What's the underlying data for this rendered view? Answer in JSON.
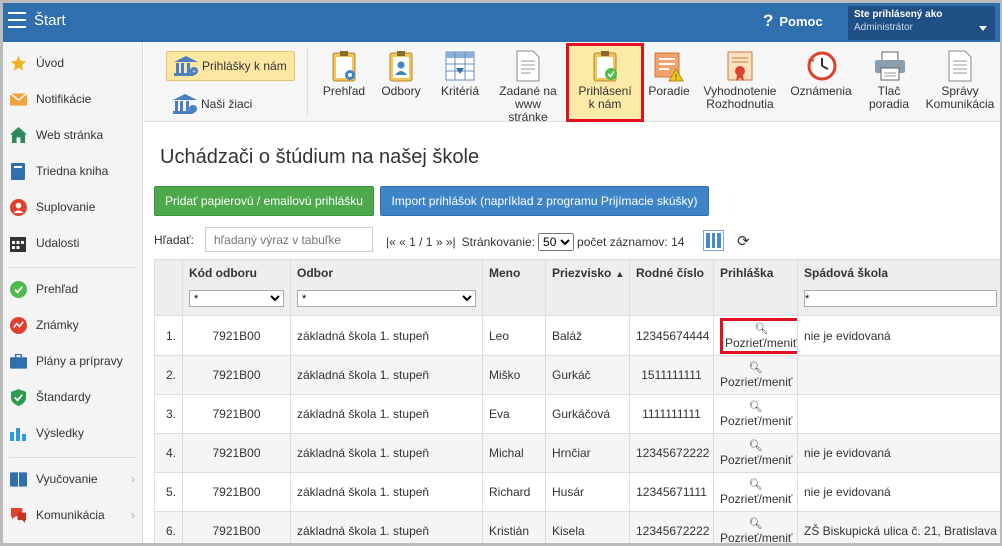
{
  "topbar": {
    "title": "Štart",
    "help_label": "Pomoc",
    "user_line1": "Ste prihlásený ako",
    "user_line2": "Administrátor"
  },
  "sidebar": {
    "items": [
      {
        "label": "Úvod",
        "icon": "star-icon"
      },
      {
        "label": "Notifikácie",
        "icon": "envelope-icon"
      },
      {
        "label": "Web stránka",
        "icon": "house-icon"
      },
      {
        "label": "Triedna kniha",
        "icon": "book-icon"
      },
      {
        "label": "Suplovanie",
        "icon": "person-icon"
      },
      {
        "label": "Udalosti",
        "icon": "calendar-icon"
      },
      {
        "label": "Prehľad",
        "icon": "check-circle-icon"
      },
      {
        "label": "Známky",
        "icon": "chart-circle-icon"
      },
      {
        "label": "Plány a prípravy",
        "icon": "briefcase-icon"
      },
      {
        "label": "Štandardy",
        "icon": "shield-icon"
      },
      {
        "label": "Výsledky",
        "icon": "bar-chart-icon"
      },
      {
        "label": "Vyučovanie",
        "icon": "books-icon"
      },
      {
        "label": "Komunikácia",
        "icon": "chat-icon"
      }
    ]
  },
  "toolbar": {
    "left": [
      {
        "label": "Prihlášky k nám",
        "icon": "school-icon"
      },
      {
        "label": "Naši žiaci",
        "icon": "school-icon"
      }
    ],
    "items": [
      {
        "line1": "Prehľad",
        "line2": "",
        "icon": "clipboard-eye-icon"
      },
      {
        "line1": "Odbory",
        "line2": "",
        "icon": "clipboard-person-icon"
      },
      {
        "line1": "Kritériá",
        "line2": "",
        "icon": "table-icon"
      },
      {
        "line1": "Zadané na",
        "line2": "www stránke",
        "icon": "document-icon"
      },
      {
        "line1": "Prihlásení",
        "line2": "k nám",
        "icon": "clipboard-check-icon"
      },
      {
        "line1": "Poradie",
        "line2": "",
        "icon": "warning-list-icon"
      },
      {
        "line1": "Vyhodnotenie",
        "line2": "Rozhodnutia",
        "icon": "certificate-icon"
      },
      {
        "line1": "Oznámenia",
        "line2": "",
        "icon": "clock-icon"
      },
      {
        "line1": "Tlač",
        "line2": "poradia",
        "icon": "printer-icon"
      },
      {
        "line1": "Správy",
        "line2": "Komunikácia",
        "icon": "message-icon"
      }
    ]
  },
  "main": {
    "title": "Uchádzači o štúdium na našej škole",
    "btn_add": "Pridať papierovú / emailovú prihlášku",
    "btn_import": "Import prihlášok (napríklad z programu Prijímacie skúšky)",
    "search_label": "Hľadať:",
    "search_placeholder": "hľadaný výraz v tabuľke",
    "pager_nav": "|« « 1 / 1 » »|",
    "pager_label": "Stránkovanie:",
    "page_size": "50",
    "count_label": "počet záznamov: 14"
  },
  "table": {
    "headers": [
      "",
      "Kód odboru",
      "Odbor",
      "Meno",
      "Priezvisko",
      "Rodné číslo",
      "Prihláška",
      "Spádová škola"
    ],
    "filter_value": "*",
    "view_label": "Pozrieť/meniť",
    "rows": [
      {
        "n": "1.",
        "code": "7921B00",
        "field": "základná škola 1. stupeň",
        "first": "Leo",
        "last": "Baláž",
        "id": "12345674444",
        "school": "nie je evidovaná"
      },
      {
        "n": "2.",
        "code": "7921B00",
        "field": "základná škola 1. stupeň",
        "first": "Miško",
        "last": "Gurkáč",
        "id": "1511111111",
        "school": ""
      },
      {
        "n": "3.",
        "code": "7921B00",
        "field": "základná škola 1. stupeň",
        "first": "Eva",
        "last": "Gurkáčová",
        "id": "1111111111",
        "school": ""
      },
      {
        "n": "4.",
        "code": "7921B00",
        "field": "základná škola 1. stupeň",
        "first": "Michal",
        "last": "Hrnčiar",
        "id": "12345672222",
        "school": "nie je evidovaná"
      },
      {
        "n": "5.",
        "code": "7921B00",
        "field": "základná škola 1. stupeň",
        "first": "Richard",
        "last": "Husár",
        "id": "12345671111",
        "school": "nie je evidovaná"
      },
      {
        "n": "6.",
        "code": "7921B00",
        "field": "základná škola 1. stupeň",
        "first": "Kristián",
        "last": "Kisela",
        "id": "12345672222",
        "school": "ZŠ Biskupická ulica č. 21, Bratislava"
      }
    ]
  }
}
